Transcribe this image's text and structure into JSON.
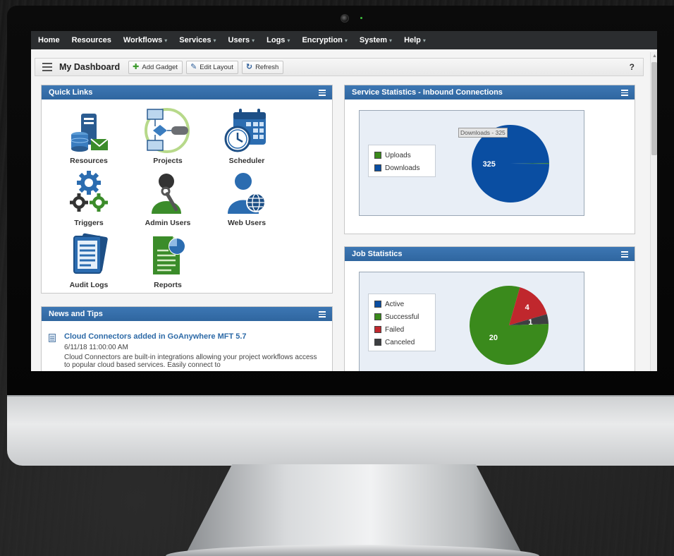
{
  "nav": {
    "items": [
      {
        "label": "Home",
        "caret": ""
      },
      {
        "label": "Resources",
        "caret": ""
      },
      {
        "label": "Workflows",
        "caret": "▾"
      },
      {
        "label": "Services",
        "caret": "▾"
      },
      {
        "label": "Users",
        "caret": "▾"
      },
      {
        "label": "Logs",
        "caret": "▾"
      },
      {
        "label": "Encryption",
        "caret": "▾"
      },
      {
        "label": "System",
        "caret": "▾"
      },
      {
        "label": "Help",
        "caret": "▾"
      }
    ]
  },
  "toolbar": {
    "title": "My Dashboard",
    "add_gadget": "Add Gadget",
    "edit_layout": "Edit Layout",
    "refresh": "Refresh",
    "help": "?"
  },
  "quick_links": {
    "title": "Quick Links",
    "items": [
      {
        "label": "Resources",
        "icon": "resources-icon"
      },
      {
        "label": "Projects",
        "icon": "projects-icon"
      },
      {
        "label": "Scheduler",
        "icon": "scheduler-icon"
      },
      {
        "label": "Triggers",
        "icon": "triggers-icon"
      },
      {
        "label": "Admin Users",
        "icon": "admin-users-icon"
      },
      {
        "label": "Web Users",
        "icon": "web-users-icon"
      },
      {
        "label": "Audit Logs",
        "icon": "audit-logs-icon"
      },
      {
        "label": "Reports",
        "icon": "reports-icon"
      }
    ]
  },
  "news": {
    "title": "News and Tips",
    "item_title": "Cloud Connectors added in GoAnywhere MFT 5.7",
    "item_date": "6/11/18 11:00:00 AM",
    "item_body": "Cloud Connectors are built-in integrations allowing your project workflows access to popular cloud based services. Easily connect to"
  },
  "service_stats": {
    "title": "Service Statistics - Inbound Connections",
    "tooltip": "Downloads - 325",
    "slice_label": "325"
  },
  "job_stats": {
    "title": "Job Statistics",
    "labels": {
      "failed": "4",
      "canceled": "1",
      "successful": "20"
    }
  },
  "chart_data": [
    {
      "type": "pie",
      "title": "Service Statistics - Inbound Connections",
      "categories": [
        "Uploads",
        "Downloads"
      ],
      "values": [
        1,
        325
      ],
      "colors": [
        "#3a8a1c",
        "#0a4ea2"
      ],
      "legend_position": "left"
    },
    {
      "type": "pie",
      "title": "Job Statistics",
      "categories": [
        "Active",
        "Successful",
        "Failed",
        "Canceled"
      ],
      "values": [
        0,
        20,
        4,
        1
      ],
      "colors": [
        "#0a4ea2",
        "#3a8a1c",
        "#c0272d",
        "#3d3f42"
      ],
      "legend_position": "left"
    }
  ]
}
